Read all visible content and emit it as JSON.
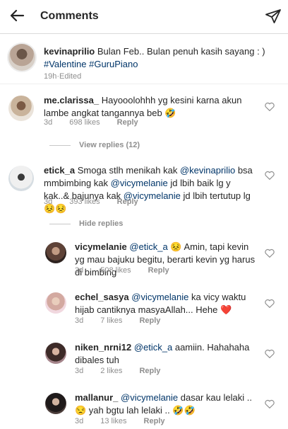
{
  "header": {
    "title": "Comments",
    "back_icon": "arrow-left-icon",
    "send_icon": "paper-plane-icon"
  },
  "caption": {
    "username": "kevinaprilio",
    "text": "Bulan Feb.. Bulan penuh kasih sayang : )",
    "hashtags": [
      "#Valentine",
      "#GuruPiano"
    ],
    "time": "19h",
    "edited": "Edited",
    "separator": " · "
  },
  "comments": [
    {
      "username": "me.clarissa_",
      "text": "Hayooolohhh yg kesini karna akun lambe angkat tangannya beb 🤣",
      "time": "3d",
      "likes": "698 likes",
      "reply": "Reply"
    },
    {
      "username": "etick_a",
      "text_1": "Smoga stlh menikah kak",
      "mention_1": "@kevinaprilio",
      "text_2": "bsa mmbimbing kak",
      "mention_2": "@vicymelanie",
      "text_3": "jd lbih baik lg y kak..& bajunya kak",
      "mention_3": "@vicymelanie",
      "text_4": "jd lbih tertutup lg😣😣",
      "time": "3d",
      "likes": "393 likes",
      "reply": "Reply"
    }
  ],
  "view_replies": "View replies (12)",
  "hide_replies": "Hide replies",
  "replies": [
    {
      "username": "vicymelanie",
      "mention": "@etick_a",
      "text": "😣 Amin, tapi kevin yg mau bajuku begitu, berarti kevin yg harus di bimbing",
      "time": "3d",
      "likes": "508 likes",
      "reply": "Reply"
    },
    {
      "username": "echel_sasya",
      "mention": "@vicymelanie",
      "text": "ka vicy waktu hijab cantiknya masyaAllah... Hehe ❤️",
      "time": "3d",
      "likes": "7 likes",
      "reply": "Reply"
    },
    {
      "username": "niken_nrni12",
      "mention": "@etick_a",
      "text": "aamiin. Hahahaha dibales tuh",
      "time": "3d",
      "likes": "2 likes",
      "reply": "Reply"
    },
    {
      "username": "mallanur_",
      "mention": "@vicymelanie",
      "text": "dasar kau lelaki .. 😒 yah bgtu lah lelaki .. 🤣🤣",
      "time": "3d",
      "likes": "13 likes",
      "reply": "Reply"
    }
  ]
}
